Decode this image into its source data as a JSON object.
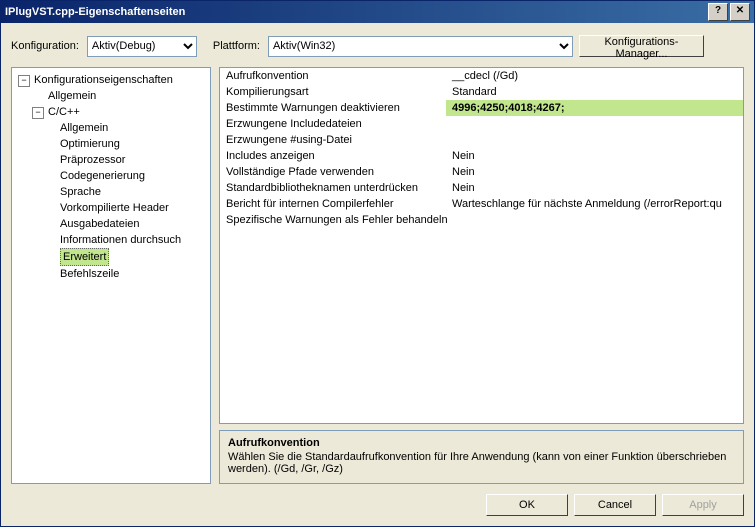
{
  "title": "IPlugVST.cpp-Eigenschaftenseiten",
  "toolbar": {
    "config_label": "Konfiguration:",
    "config_value": "Aktiv(Debug)",
    "platform_label": "Plattform:",
    "platform_value": "Aktiv(Win32)",
    "kfg_manager": "Konfigurations-Manager..."
  },
  "tree": {
    "root": "Konfigurationseigenschaften",
    "l1_general": "Allgemein",
    "cpp": "C/C++",
    "items": [
      "Allgemein",
      "Optimierung",
      "Präprozessor",
      "Codegenerierung",
      "Sprache",
      "Vorkompilierte Header",
      "Ausgabedateien",
      "Informationen durchsuch",
      "Erweitert",
      "Befehlszeile"
    ]
  },
  "grid": [
    {
      "label": "Aufrufkonvention",
      "value": "__cdecl (/Gd)"
    },
    {
      "label": "Kompilierungsart",
      "value": "Standard"
    },
    {
      "label": "Bestimmte Warnungen deaktivieren",
      "value": "4996;4250;4018;4267;",
      "hl": true
    },
    {
      "label": "Erzwungene Includedateien",
      "value": ""
    },
    {
      "label": "Erzwungene #using-Datei",
      "value": ""
    },
    {
      "label": "Includes anzeigen",
      "value": "Nein"
    },
    {
      "label": "Vollständige Pfade verwenden",
      "value": "Nein"
    },
    {
      "label": "Standardbibliotheknamen unterdrücken",
      "value": "Nein"
    },
    {
      "label": "Bericht für internen Compilerfehler",
      "value": "Warteschlange für nächste Anmeldung (/errorReport:qu"
    },
    {
      "label": "Spezifische Warnungen als Fehler behandeln",
      "value": ""
    }
  ],
  "help": {
    "title": "Aufrufkonvention",
    "body": "Wählen Sie die Standardaufrufkonvention für Ihre Anwendung (kann von einer Funktion überschrieben werden).     (/Gd, /Gr, /Gz)"
  },
  "footer": {
    "ok": "OK",
    "cancel": "Cancel",
    "apply": "Apply"
  }
}
